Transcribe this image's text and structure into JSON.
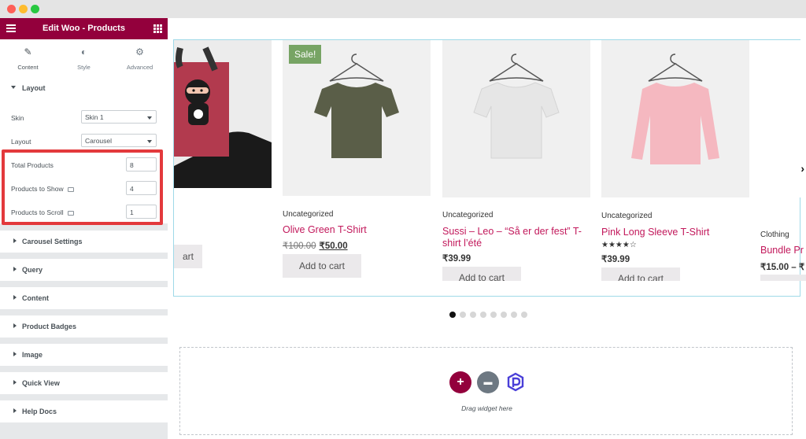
{
  "editor": {
    "title": "Edit Woo - Products",
    "tabs": [
      {
        "label": "Content",
        "icon": "pencil-icon",
        "active": true
      },
      {
        "label": "Style",
        "icon": "contrast-icon",
        "active": false
      },
      {
        "label": "Advanced",
        "icon": "gear-icon",
        "active": false
      }
    ],
    "layout_section": "Layout",
    "controls": {
      "skin_label": "Skin",
      "skin_value": "Skin 1",
      "layout_label": "Layout",
      "layout_value": "Carousel",
      "total_label": "Total Products",
      "total_value": "8",
      "show_label": "Products to Show",
      "show_value": "4",
      "scroll_label": "Products to Scroll",
      "scroll_value": "1"
    },
    "sections": [
      "Carousel Settings",
      "Query",
      "Content",
      "Product Badges",
      "Image",
      "Quick View",
      "Help Docs"
    ],
    "accent": "#93003c",
    "highlight_color": "#e3393c"
  },
  "products": [
    {
      "button": "Add to cart",
      "button_partial": "art"
    },
    {
      "sale": "Sale!",
      "category": "Uncategorized",
      "name": "Olive Green T-Shirt",
      "old_price": "₹100.00",
      "price": "₹50.00",
      "button": "Add to cart",
      "color": "#5a5e48"
    },
    {
      "category": "Uncategorized",
      "name_line1": "Sussi – Leo – “Så er der fest” T-",
      "name_line2": "shirt l’été",
      "price": "₹39.99",
      "button": "Add to cart",
      "color": "#e9e9e9"
    },
    {
      "category": "Uncategorized",
      "name": "Pink Long Sleeve T-Shirt",
      "rating": "★★★★☆",
      "price": "₹39.99",
      "button": "Add to cart",
      "color": "#f5b8c0"
    },
    {
      "category": "Clothing",
      "name": "Bundle Pr",
      "price": "₹15.00 – ₹"
    }
  ],
  "carousel": {
    "dot_count": 8,
    "active_dot": 1
  },
  "dropzone": {
    "hint": "Drag widget here",
    "plus": "+",
    "folder": "▬"
  }
}
